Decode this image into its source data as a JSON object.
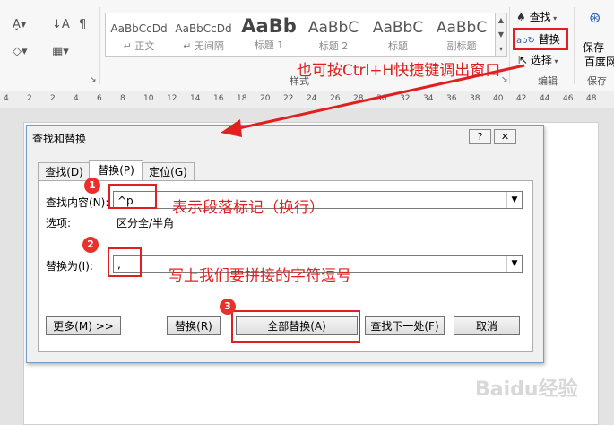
{
  "ribbon": {
    "styles": [
      {
        "sample": "AaBbCcDd",
        "name": "↵ 正文"
      },
      {
        "sample": "AaBbCcDd",
        "name": "↵ 无间隔"
      },
      {
        "sample": "AaBb",
        "name": "标题 1"
      },
      {
        "sample": "AaBbC",
        "name": "标题 2"
      },
      {
        "sample": "AaBbC",
        "name": "标题"
      },
      {
        "sample": "AaBbC",
        "name": "副标题"
      }
    ],
    "styles_group_label": "样式",
    "find_label": "查找",
    "replace_label": "替换",
    "select_label": "选择",
    "edit_group_label": "编辑",
    "save_label_1": "保存",
    "save_label_2": "百度网",
    "save_group_label": "保存"
  },
  "ruler": {
    "ticks": [
      "4",
      "2",
      "2",
      "4",
      "6",
      "8",
      "10",
      "12",
      "14",
      "16",
      "18",
      "20",
      "22",
      "24",
      "26",
      "28",
      "30",
      "32",
      "34",
      "36",
      "38",
      "40",
      "42",
      "44",
      "46",
      "48"
    ]
  },
  "dialog": {
    "title": "查找和替换",
    "help_btn": "?",
    "close_btn": "✕",
    "tabs": [
      "查找(D)",
      "替换(P)",
      "定位(G)"
    ],
    "find_label": "查找内容(N):",
    "find_value": "^p",
    "options_label": "选项:",
    "options_value": "区分全/半角",
    "replace_label": "替换为(I):",
    "replace_value": ",",
    "more_btn": "更多(M) >>",
    "replace_btn": "替换(R)",
    "replace_all_btn": "全部替换(A)",
    "find_next_btn": "查找下一处(F)",
    "cancel_btn": "取消"
  },
  "annotations": {
    "hint_top": "也可按Ctrl+H快捷键调出窗口",
    "step1": "1",
    "step1_text": "表示段落标记（换行）",
    "step2": "2",
    "step2_text": "写上我们要拼接的字符逗号",
    "step3": "3"
  },
  "watermark": "Baidu经验"
}
